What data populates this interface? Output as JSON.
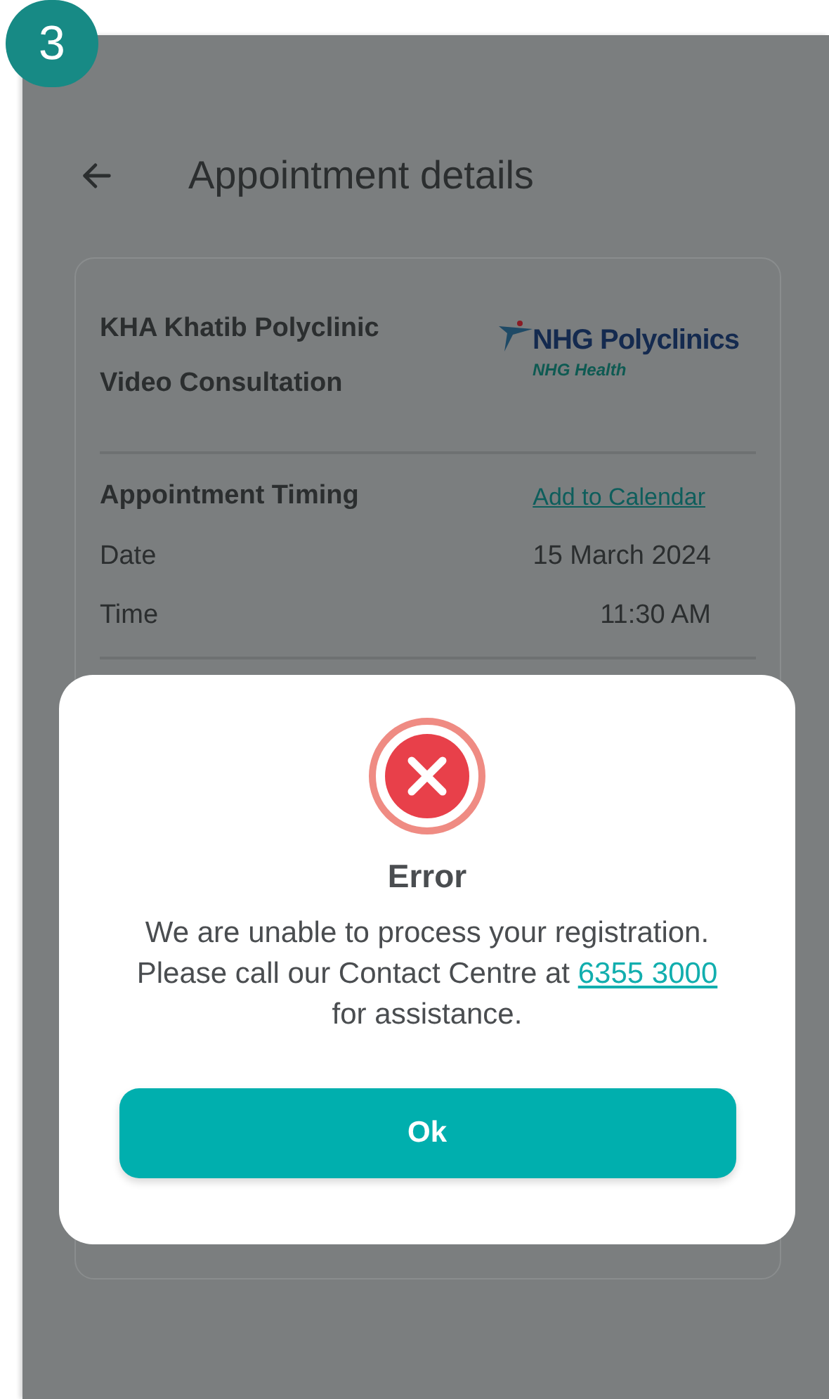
{
  "step_badge": "3",
  "header": {
    "title": "Appointment details"
  },
  "card": {
    "clinic": "KHA Khatib Polyclinic",
    "service": "Video Consultation",
    "logo": {
      "name": "NHG Polyclinics",
      "tagline": "NHG Health"
    },
    "section": {
      "title": "Appointment Timing",
      "action": "Add to Calendar"
    },
    "rows": [
      {
        "label": "Date",
        "value": "15 March 2024"
      },
      {
        "label": "Time",
        "value": "11:30 AM"
      }
    ]
  },
  "dialog": {
    "title": "Error",
    "message_before": "We are unable to process your registration. Please call our Contact Centre at",
    "phone": "6355 3000",
    "message_after": "for assistance.",
    "button": "Ok"
  }
}
